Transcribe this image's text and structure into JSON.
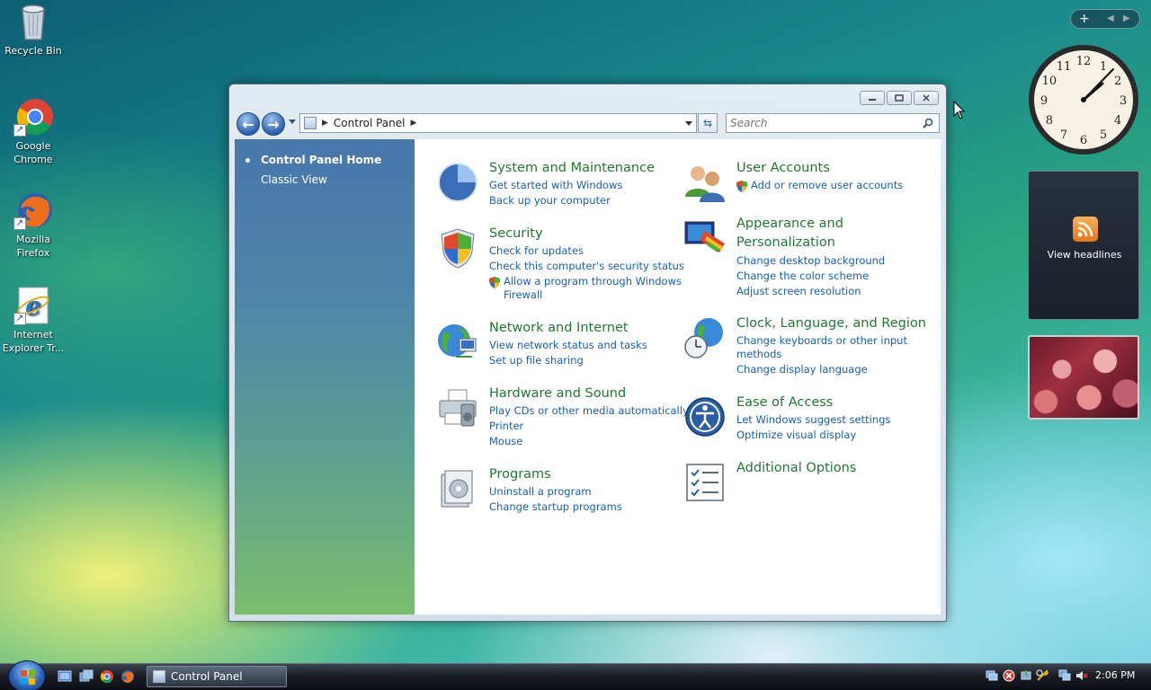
{
  "desktop": {
    "icons": [
      {
        "label": "Recycle Bin"
      },
      {
        "label": "Google\nChrome"
      },
      {
        "label": "Mozilla\nFirefox"
      },
      {
        "label": "Internet\nExplorer Tr..."
      }
    ]
  },
  "window": {
    "address": {
      "crumb": "Control Panel"
    },
    "search": {
      "placeholder": "Search"
    },
    "left_pane": {
      "items": [
        {
          "label": "Control Panel Home",
          "selected": true
        },
        {
          "label": "Classic View",
          "selected": false
        }
      ]
    },
    "categories": [
      {
        "title": "System and Maintenance",
        "links": [
          "Get started with Windows",
          "Back up your computer"
        ],
        "icon": "system-maintenance-icon"
      },
      {
        "title": "Security",
        "links": [
          "Check for updates",
          "Check this computer's security status",
          "Allow a program through Windows",
          "Firewall"
        ],
        "icon": "security-shield-icon"
      },
      {
        "title": "Network and Internet",
        "links": [
          "View network status and tasks",
          "Set up file sharing"
        ],
        "icon": "network-globe-icon"
      },
      {
        "title": "Hardware and Sound",
        "links": [
          "Play CDs or other media automatically",
          "Printer",
          "Mouse"
        ],
        "icon": "hardware-printer-icon"
      },
      {
        "title": "Programs",
        "links": [
          "Uninstall a program",
          "Change startup programs"
        ],
        "icon": "programs-icon"
      },
      {
        "title": "User Accounts",
        "links": [
          "Add or remove user accounts"
        ],
        "icon": "user-accounts-icon"
      },
      {
        "title": "Appearance and",
        "title2": "Personalization",
        "links": [
          "Change desktop background",
          "Change the color scheme",
          "Adjust screen resolution"
        ],
        "icon": "appearance-icon"
      },
      {
        "title": "Clock, Language, and Region",
        "links": [
          "Change keyboards or other input",
          "methods",
          "Change display language"
        ],
        "icon": "clock-globe-icon"
      },
      {
        "title": "Ease of Access",
        "links": [
          "Let Windows suggest settings",
          "Optimize visual display"
        ],
        "icon": "ease-of-access-icon"
      },
      {
        "title": "Additional Options",
        "links": [],
        "icon": "checklist-icon"
      }
    ]
  },
  "sidebar_gadgets": {
    "feed_label": "View headlines",
    "clock_numbers": [
      "12",
      "1",
      "2",
      "3",
      "4",
      "5",
      "6",
      "7",
      "8",
      "9",
      "10",
      "11"
    ]
  },
  "taskbar": {
    "active_task": "Control Panel",
    "time": "2:06 PM"
  },
  "colors": {
    "category_title": "#1e7a2e",
    "link": "#1560b8",
    "left_pane_top": "#4977ac",
    "left_pane_bottom": "#7bbd6c"
  }
}
